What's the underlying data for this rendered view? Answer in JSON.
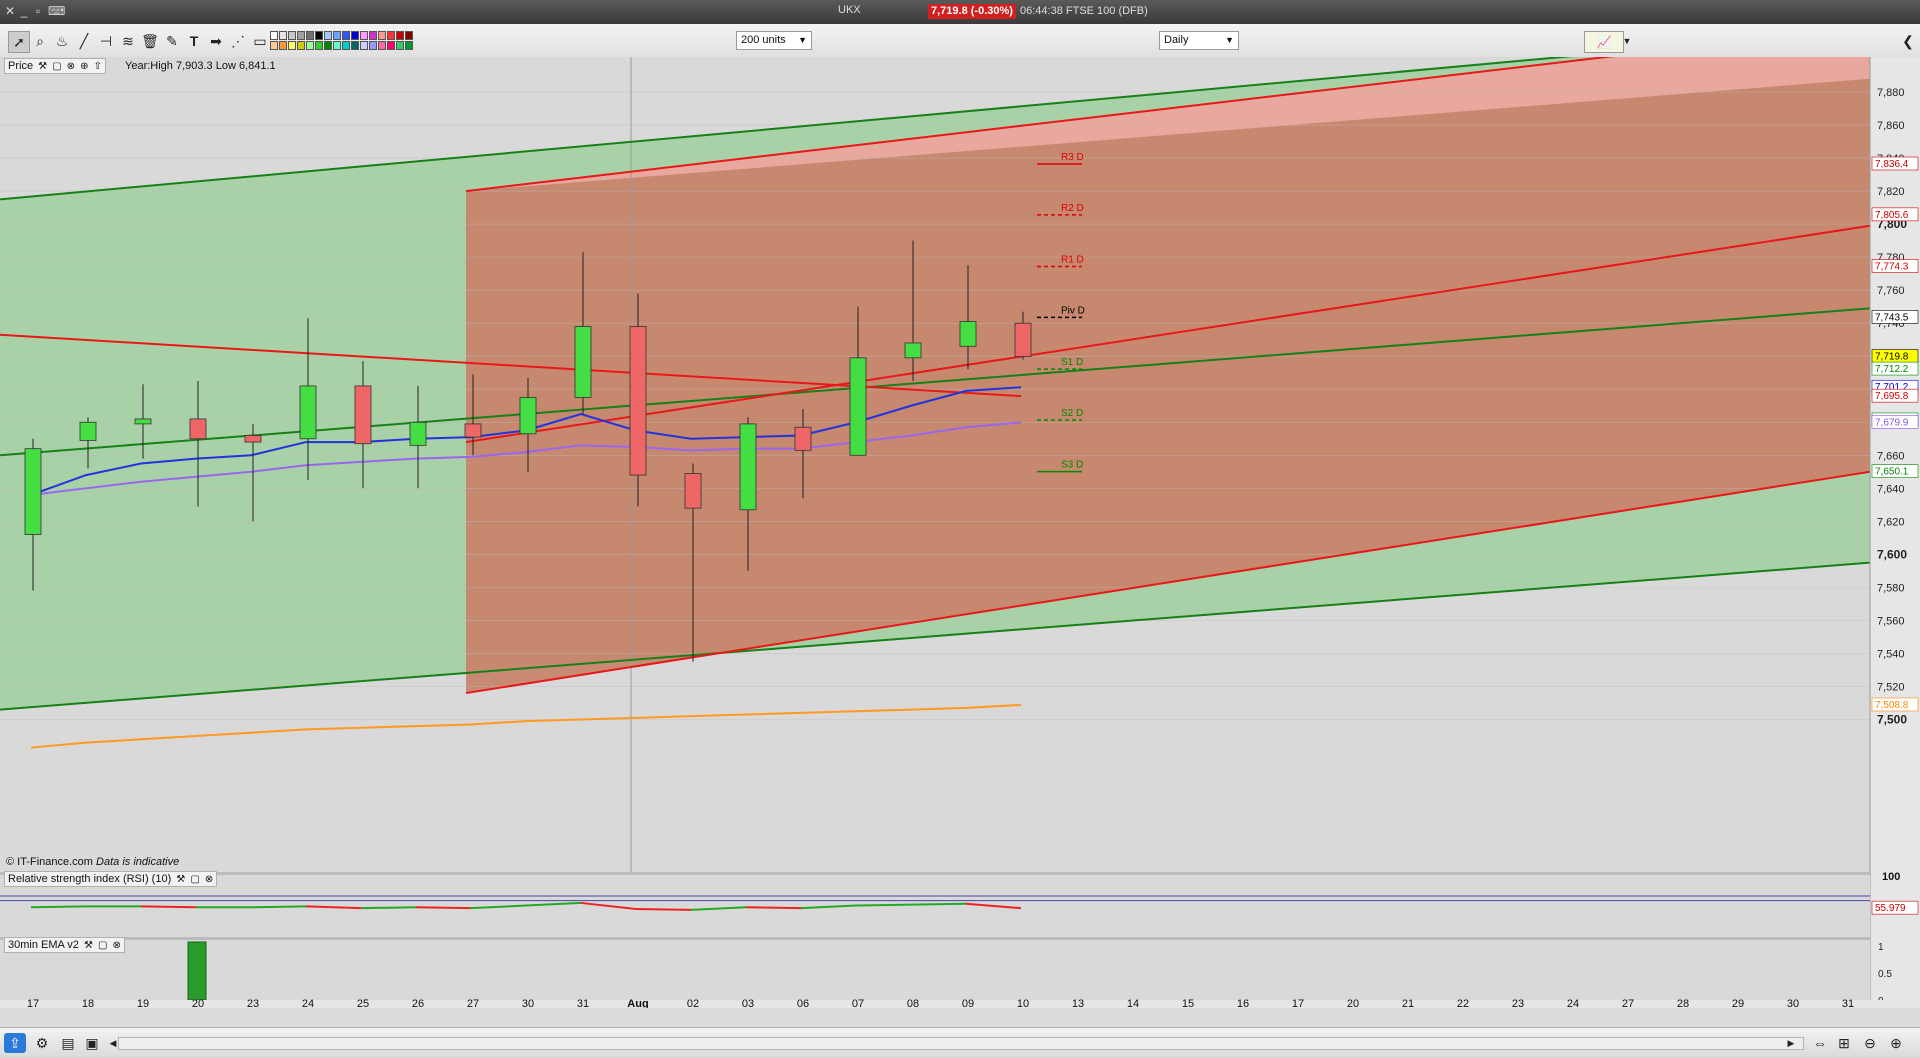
{
  "titlebar": {
    "symbol": "UKX",
    "price_badge": "7,719.8 (-0.30%)",
    "clock_text": "06:44:38 FTSE 100 (DFB)"
  },
  "toolbar": {
    "units_select": "200 units",
    "period_select": "Daily",
    "text_tool_label": "T",
    "swatch_colors": [
      "#ffffff",
      "#e6e6e6",
      "#c8c8c8",
      "#a0a0a0",
      "#707070",
      "#000000",
      "#9ec6ff",
      "#6aa0ff",
      "#3355ff",
      "#0000cc",
      "#ff99ff",
      "#cc33cc",
      "#ff9999",
      "#ff3333",
      "#cc0000",
      "#880000",
      "#ffcc99",
      "#ff9933",
      "#ffff66",
      "#cccc00",
      "#99ff99",
      "#33cc33",
      "#008800",
      "#66ffcc",
      "#00cccc",
      "#006666",
      "#ccccff",
      "#9999ff",
      "#ff66aa",
      "#ff0066",
      "#33cc66",
      "#009933"
    ]
  },
  "panels": {
    "price_label": "Price",
    "price_info": "Year:High 7,903.3 Low 6,841.1",
    "rsi_label": "Relative strength index (RSI) (10)",
    "ema_label": "30min EMA v2",
    "copyright": "© IT-Finance.com",
    "indicative": "Data is indicative"
  },
  "chart_data": {
    "type": "candlestick",
    "ylim": [
      7490,
      7890
    ],
    "y_ticks": [
      7500,
      7520,
      7540,
      7560,
      7580,
      7600,
      7620,
      7640,
      7660,
      7680,
      7700,
      7720,
      7740,
      7760,
      7780,
      7800,
      7820,
      7840,
      7860,
      7880
    ],
    "x_labels": [
      "17",
      "18",
      "19",
      "20",
      "23",
      "24",
      "25",
      "26",
      "27",
      "30",
      "31",
      "Aug",
      "02",
      "03",
      "06",
      "07",
      "08",
      "09",
      "10",
      "13",
      "14",
      "15",
      "16",
      "17",
      "20",
      "21",
      "22",
      "23",
      "24",
      "27",
      "28",
      "29",
      "30",
      "31"
    ],
    "candles": [
      {
        "date": "17",
        "open": 7612,
        "high": 7670,
        "low": 7578,
        "close": 7664
      },
      {
        "date": "18",
        "open": 7669,
        "high": 7683,
        "low": 7652,
        "close": 7680
      },
      {
        "date": "19",
        "open": 7679,
        "high": 7703,
        "low": 7658,
        "close": 7682
      },
      {
        "date": "20",
        "open": 7682,
        "high": 7705,
        "low": 7629,
        "close": 7670
      },
      {
        "date": "23",
        "open": 7672,
        "high": 7679,
        "low": 7620,
        "close": 7668
      },
      {
        "date": "24",
        "open": 7670,
        "high": 7743,
        "low": 7645,
        "close": 7702
      },
      {
        "date": "25",
        "open": 7702,
        "high": 7717,
        "low": 7640,
        "close": 7667
      },
      {
        "date": "26",
        "open": 7666,
        "high": 7702,
        "low": 7640,
        "close": 7680
      },
      {
        "date": "27",
        "open": 7679,
        "high": 7709,
        "low": 7660,
        "close": 7671
      },
      {
        "date": "30",
        "open": 7673,
        "high": 7707,
        "low": 7650,
        "close": 7695
      },
      {
        "date": "31",
        "open": 7695,
        "high": 7783,
        "low": 7685,
        "close": 7738
      },
      {
        "date": "01",
        "open": 7738,
        "high": 7758,
        "low": 7629,
        "close": 7648
      },
      {
        "date": "02",
        "open": 7649,
        "high": 7655,
        "low": 7535,
        "close": 7628
      },
      {
        "date": "03",
        "open": 7627,
        "high": 7683,
        "low": 7590,
        "close": 7679
      },
      {
        "date": "06",
        "open": 7677,
        "high": 7688,
        "low": 7634,
        "close": 7663
      },
      {
        "date": "07",
        "open": 7660,
        "high": 7750,
        "low": 7660,
        "close": 7719
      },
      {
        "date": "08",
        "open": 7719,
        "high": 7790,
        "low": 7705,
        "close": 7728
      },
      {
        "date": "09",
        "open": 7726,
        "high": 7775,
        "low": 7712,
        "close": 7741
      },
      {
        "date": "10",
        "open": 7740,
        "high": 7747,
        "low": 7718,
        "close": 7719.8
      }
    ],
    "pivots": [
      {
        "label": "R3 D",
        "value": 7836.4,
        "color": "#e00000"
      },
      {
        "label": "R2 D",
        "value": 7805.6,
        "color": "#e00000"
      },
      {
        "label": "R1 D",
        "value": 7774.3,
        "color": "#e00000"
      },
      {
        "label": "Piv D",
        "value": 7743.5,
        "color": "#000000"
      },
      {
        "label": "S1 D",
        "value": 7712.2,
        "color": "#008800"
      },
      {
        "label": "S2 D",
        "value": 7681.4,
        "color": "#008800"
      },
      {
        "label": "S3 D",
        "value": 7650.1,
        "color": "#008800"
      }
    ],
    "price_tags": [
      {
        "value": 7836.4,
        "text": "7,836.4",
        "color": "#cc0000",
        "bg": "#ffffff"
      },
      {
        "value": 7805.6,
        "text": "7,805.6",
        "color": "#cc0000",
        "bg": "#ffffff"
      },
      {
        "value": 7774.3,
        "text": "7,774.3",
        "color": "#cc0000",
        "bg": "#ffffff"
      },
      {
        "value": 7743.5,
        "text": "7,743.5",
        "color": "#000000",
        "bg": "#ffffff"
      },
      {
        "value": 7719.8,
        "text": "7,719.8",
        "color": "#000000",
        "bg": "#ffff00"
      },
      {
        "value": 7712.2,
        "text": "7,712.2",
        "color": "#008800",
        "bg": "#ffffff"
      },
      {
        "value": 7701.2,
        "text": "7,701.2",
        "color": "#0000cc",
        "bg": "#ffffff"
      },
      {
        "value": 7695.8,
        "text": "7,695.8",
        "color": "#cc0000",
        "bg": "#ffffff"
      },
      {
        "value": 7681.4,
        "text": "7,681.4",
        "color": "#008800",
        "bg": "#ffffff"
      },
      {
        "value": 7679.9,
        "text": "7,679.9",
        "color": "#8855ee",
        "bg": "#ffffff"
      },
      {
        "value": 7650.1,
        "text": "7,650.1",
        "color": "#008800",
        "bg": "#ffffff"
      },
      {
        "value": 7508.8,
        "text": "7,508.8",
        "color": "#ff8800",
        "bg": "#ffffff"
      }
    ],
    "ma_blue": [
      7636,
      7648,
      7655,
      7658,
      7660,
      7668,
      7668,
      7670,
      7671,
      7675,
      7685,
      7675,
      7670,
      7671,
      7672,
      7680,
      7690,
      7699,
      7701.2
    ],
    "ma_purple": [
      7636,
      7640,
      7644,
      7647,
      7650,
      7654,
      7656,
      7658,
      7659,
      7662,
      7666,
      7665,
      7663,
      7664,
      7664,
      7668,
      7672,
      7677,
      7679.9
    ],
    "ma_orange": [
      7483,
      7486,
      7488,
      7490,
      7492,
      7494,
      7495,
      7496,
      7497,
      7499,
      7500,
      7501,
      7502,
      7503,
      7504,
      7505,
      7506,
      7507,
      7508.8
    ],
    "rsi": {
      "value_label": "55.979",
      "ylim_label": "100",
      "values": [
        57,
        58,
        58,
        57,
        57,
        58,
        56,
        57,
        56,
        59,
        62,
        55,
        54,
        57,
        56,
        59,
        60,
        61,
        55.979
      ]
    },
    "ema": {
      "ticks": [
        "1",
        "0.5",
        "0"
      ],
      "bar_date": "20",
      "bar_value": 1
    }
  }
}
